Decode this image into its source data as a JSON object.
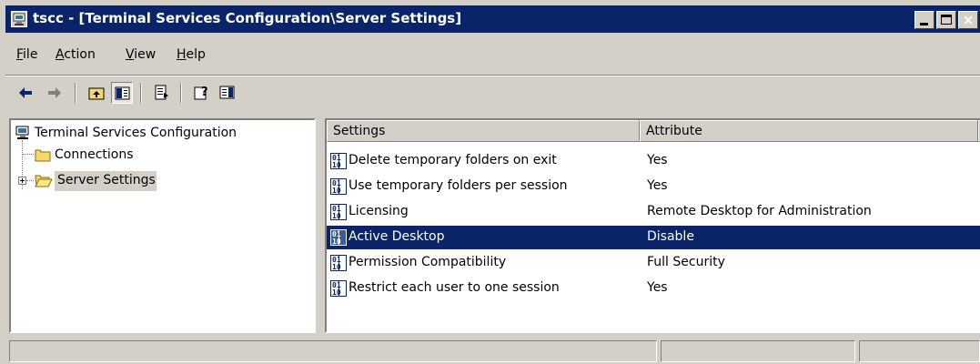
{
  "window": {
    "title": "tscc - [Terminal Services Configuration\\Server Settings]",
    "title_bar_color": "#0a246a",
    "icon": "computer-icon",
    "controls": {
      "minimize": "minimize-icon",
      "maximize": "maximize-icon",
      "close": "close-icon",
      "close_glyph": "×"
    }
  },
  "menu": {
    "items": [
      {
        "label": "File",
        "accel": "F",
        "rest": "ile"
      },
      {
        "label": "Action",
        "accel": "A",
        "rest": "ction"
      },
      {
        "label": "View",
        "accel": "V",
        "rest": "iew"
      },
      {
        "label": "Help",
        "accel": "H",
        "rest": "elp"
      }
    ]
  },
  "toolbar": {
    "buttons": [
      {
        "name": "back",
        "icon": "back-arrow-icon"
      },
      {
        "name": "forward",
        "icon": "forward-arrow-icon"
      },
      {
        "name": "up-one-level",
        "icon": "folder-up-icon"
      },
      {
        "name": "show-hide-console-tree",
        "icon": "console-tree-icon",
        "pressed": true
      },
      {
        "name": "export-list",
        "icon": "export-list-icon"
      },
      {
        "name": "help",
        "icon": "help-icon"
      },
      {
        "name": "show-hide-action-pane",
        "icon": "action-pane-icon"
      }
    ]
  },
  "tree": {
    "root": {
      "label": "Terminal Services Configuration",
      "icon": "computer-icon"
    },
    "children": [
      {
        "label": "Connections",
        "icon": "folder-icon"
      },
      {
        "label": "Server Settings",
        "icon": "open-folder-icon",
        "selected": true,
        "expandable": true
      }
    ]
  },
  "list": {
    "columns": [
      {
        "label": "Settings"
      },
      {
        "label": "Attribute"
      }
    ],
    "rows": [
      {
        "setting": "Delete temporary folders on exit",
        "attribute": "Yes",
        "icon": "setting-icon"
      },
      {
        "setting": "Use temporary folders per session",
        "attribute": "Yes",
        "icon": "setting-icon"
      },
      {
        "setting": "Licensing",
        "attribute": "Remote Desktop for Administration",
        "icon": "setting-icon"
      },
      {
        "setting": "Active Desktop",
        "attribute": "Disable",
        "icon": "setting-icon",
        "selected": true
      },
      {
        "setting": "Permission Compatibility",
        "attribute": "Full Security",
        "icon": "setting-icon"
      },
      {
        "setting": "Restrict each user to one session",
        "attribute": "Yes",
        "icon": "setting-icon"
      }
    ],
    "selection_color": "#0a246a"
  },
  "statusbar": {
    "panels": [
      "",
      "",
      ""
    ]
  }
}
